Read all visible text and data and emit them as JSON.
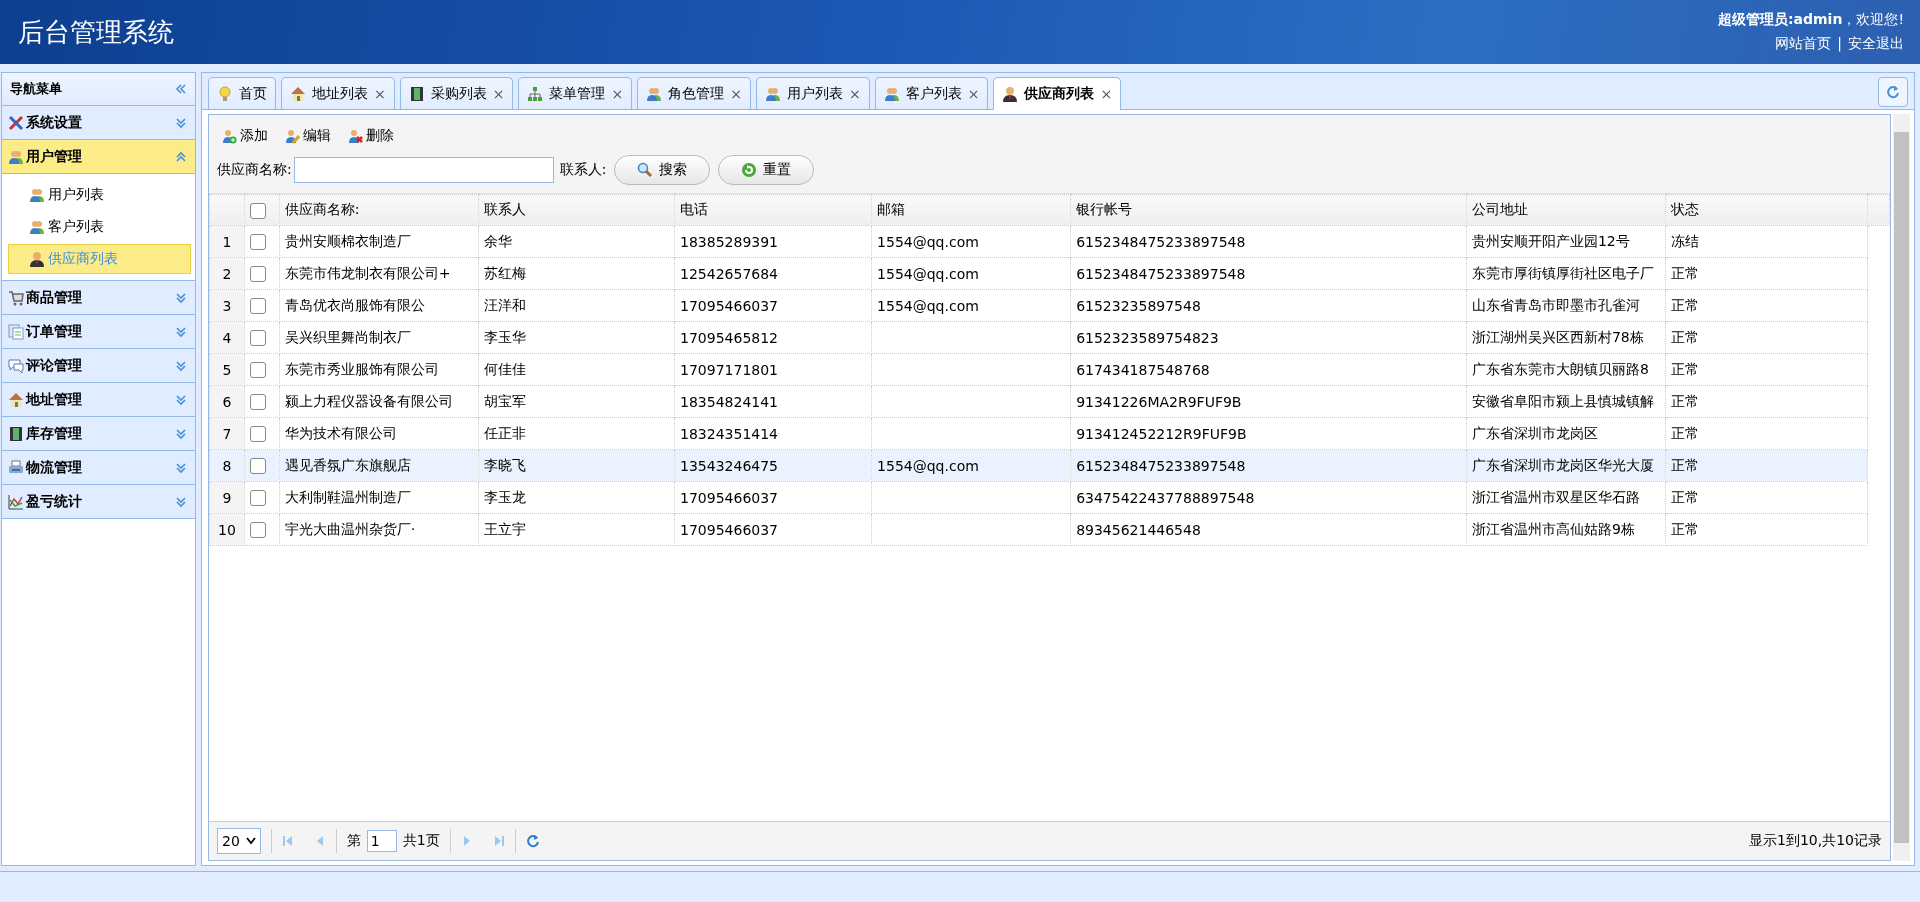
{
  "header": {
    "title": "后台管理系统",
    "welcome": "**超级管理员:admin**，欢迎您!",
    "links": [
      "网站首页",
      "安全退出"
    ],
    "separator": "|"
  },
  "sidebar": {
    "title": "导航菜单",
    "groups": [
      {
        "label": "系统设置",
        "expanded": false
      },
      {
        "label": "用户管理",
        "expanded": true,
        "children": [
          {
            "label": "用户列表",
            "selected": false
          },
          {
            "label": "客户列表",
            "selected": false
          },
          {
            "label": "供应商列表",
            "selected": true
          }
        ]
      },
      {
        "label": "商品管理",
        "expanded": false
      },
      {
        "label": "订单管理",
        "expanded": false
      },
      {
        "label": "评论管理",
        "expanded": false
      },
      {
        "label": "地址管理",
        "expanded": false
      },
      {
        "label": "库存管理",
        "expanded": false
      },
      {
        "label": "物流管理",
        "expanded": false
      },
      {
        "label": "盈亏统计",
        "expanded": false
      }
    ]
  },
  "tabs": [
    {
      "label": "首页",
      "selected": false
    },
    {
      "label": "地址列表",
      "selected": false,
      "close": "×"
    },
    {
      "label": "采购列表",
      "selected": false,
      "close": "×"
    },
    {
      "label": "菜单管理",
      "selected": false,
      "close": "×"
    },
    {
      "label": "角色管理",
      "selected": false,
      "close": "×"
    },
    {
      "label": "用户列表",
      "selected": false,
      "close": "×"
    },
    {
      "label": "客户列表",
      "selected": false,
      "close": "×"
    },
    {
      "label": "供应商列表",
      "selected": true,
      "close": "×"
    }
  ],
  "toolbar": [
    "添加",
    "编辑",
    "删除"
  ],
  "search": {
    "name_label": "供应商名称:",
    "contact_label": "联系人:",
    "buttons": [
      "搜索",
      "重置"
    ]
  },
  "table": {
    "columns": [
      "供应商名称:",
      "联系人",
      "电话",
      "邮箱",
      "银行帐号",
      "公司地址",
      "状态"
    ],
    "header_checked": false,
    "rows": [
      {
        "num": "1",
        "checked": false,
        "selected": false,
        "cells": [
          "贵州安顺棉衣制造厂",
          "余华",
          "18385289391",
          "1554@qq.com",
          "6152348475233897548",
          "贵州安顺开阳产业园12号",
          "冻结"
        ]
      },
      {
        "num": "2",
        "checked": false,
        "selected": false,
        "cells": [
          "东莞市伟龙制衣有限公司+",
          "苏红梅",
          "12542657684",
          "1554@qq.com",
          "6152348475233897548",
          "东莞市厚街镇厚街社区电子厂",
          "正常"
        ]
      },
      {
        "num": "3",
        "checked": false,
        "selected": false,
        "cells": [
          "青岛优衣尚服饰有限公",
          "汪洋和",
          "17095466037",
          "1554@qq.com",
          "61523235897548",
          "山东省青岛市即墨市孔雀河",
          "正常"
        ]
      },
      {
        "num": "4",
        "checked": false,
        "selected": false,
        "cells": [
          "吴兴织里舞尚制衣厂",
          "李玉华",
          "17095465812",
          "",
          "6152323589754823",
          "浙江湖州吴兴区西新村78栋",
          "正常"
        ]
      },
      {
        "num": "5",
        "checked": false,
        "selected": false,
        "cells": [
          "东莞市秀业服饰有限公司",
          "何佳佳",
          "17097171801",
          "",
          "617434187548768",
          "广东省东莞市大朗镇贝丽路8",
          "正常"
        ]
      },
      {
        "num": "6",
        "checked": false,
        "selected": false,
        "cells": [
          "颍上力程仪器设备有限公司",
          "胡宝军",
          "18354824141",
          "",
          "91341226MA2R9FUF9B",
          "安徽省阜阳市颍上县慎城镇解",
          "正常"
        ]
      },
      {
        "num": "7",
        "checked": false,
        "selected": false,
        "cells": [
          "华为技术有限公司",
          "任正非",
          "18324351414",
          "",
          "913412452212R9FUF9B",
          "广东省深圳市龙岗区",
          "正常"
        ]
      },
      {
        "num": "8",
        "checked": false,
        "selected": true,
        "cells": [
          "遇见香氛广东旗舰店",
          "李晓飞",
          "13543246475",
          "1554@qq.com",
          "6152348475233897548",
          "广东省深圳市龙岗区华光大厦",
          "正常"
        ]
      },
      {
        "num": "9",
        "checked": false,
        "selected": false,
        "cells": [
          "大利制鞋温州制造厂",
          "李玉龙",
          "17095466037",
          "",
          "63475422437788897548",
          "浙江省温州市双星区华石路",
          "正常"
        ]
      },
      {
        "num": "10",
        "checked": false,
        "selected": false,
        "cells": [
          "宇光大曲温州杂货厂·",
          "王立宇",
          "17095466037",
          "",
          "89345621446548",
          "浙江省温州市高仙姑路9栋",
          "正常"
        ]
      }
    ]
  },
  "pager": {
    "page_size": "20",
    "page_prefix": "第",
    "page": "1",
    "page_total": "共1页",
    "summary": "显示1到10,共10记录"
  }
}
